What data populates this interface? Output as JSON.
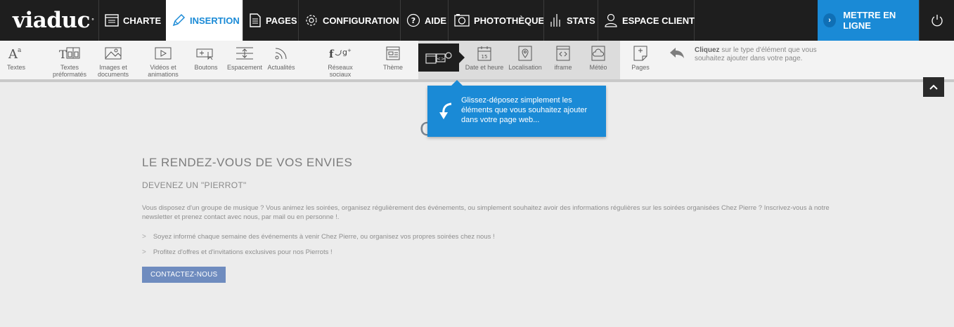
{
  "brand": {
    "name": "viaduc"
  },
  "nav": {
    "items": [
      {
        "label": "CHARTE",
        "icon": "charte-icon"
      },
      {
        "label": "INSERTION",
        "icon": "pencil-icon",
        "active": true
      },
      {
        "label": "PAGES",
        "icon": "pages-icon"
      },
      {
        "label": "CONFIGURATION",
        "icon": "gear-icon"
      },
      {
        "label": "AIDE",
        "icon": "help-icon"
      },
      {
        "label": "PHOTOTHÈQUE",
        "icon": "camera-icon"
      },
      {
        "label": "STATS",
        "icon": "stats-icon"
      },
      {
        "label": "ESPACE CLIENT",
        "icon": "user-icon"
      }
    ],
    "publish_label": "METTRE EN LIGNE",
    "accent_color": "#1a8ad6"
  },
  "tools": [
    {
      "label": "Textes",
      "icon": "text-icon"
    },
    {
      "label": "Textes\npréformatés",
      "icon": "preformatted-text-icon"
    },
    {
      "label": "Images et\ndocuments",
      "icon": "image-icon"
    },
    {
      "label": "Vidéos et\nanimations",
      "icon": "video-icon"
    },
    {
      "label": "Boutons",
      "icon": "button-icon"
    },
    {
      "label": "Espacement",
      "icon": "spacing-icon"
    },
    {
      "label": "Actualités",
      "icon": "rss-icon"
    },
    {
      "label": "Réseaux\nsociaux",
      "icon": "social-icon"
    },
    {
      "label": "Thème",
      "icon": "theme-icon"
    },
    {
      "label": "Date et heure",
      "icon": "calendar-icon"
    },
    {
      "label": "Localisation",
      "icon": "location-icon"
    },
    {
      "label": "iframe",
      "icon": "iframe-icon"
    },
    {
      "label": "Météo",
      "icon": "weather-icon"
    },
    {
      "label": "Pages",
      "icon": "page-add-icon"
    }
  ],
  "hint": {
    "bold": "Cliquez",
    "text": " sur le type d'élément que vous souhaitez ajouter dans votre page."
  },
  "tooltip": {
    "text": "Glissez-déposez simplement les éléments que vous souhaitez ajouter dans votre page web..."
  },
  "page": {
    "hidden_title": "CHEZ PIERRE",
    "heading": "LE RENDEZ-VOUS DE VOS ENVIES",
    "subheading": "DEVENEZ UN \"PIERROT\"",
    "paragraph": "Vous disposez d'un groupe de musique ? Vous animez les soirées, organisez régulièrement des événements, ou simplement souhaitez avoir des informations régulières sur les soirées organisées Chez Pierre ? Inscrivez-vous à notre newsletter et prenez contact avec nous, par mail ou en personne !.",
    "bullets": [
      "Soyez informé chaque semaine des événements à venir Chez Pierre, ou organisez vos propres soirées chez nous !",
      "Profitez d'offres et d'invitations exclusives pour nos Pierrots !"
    ],
    "button_label": "CONTACTEZ-NOUS"
  }
}
